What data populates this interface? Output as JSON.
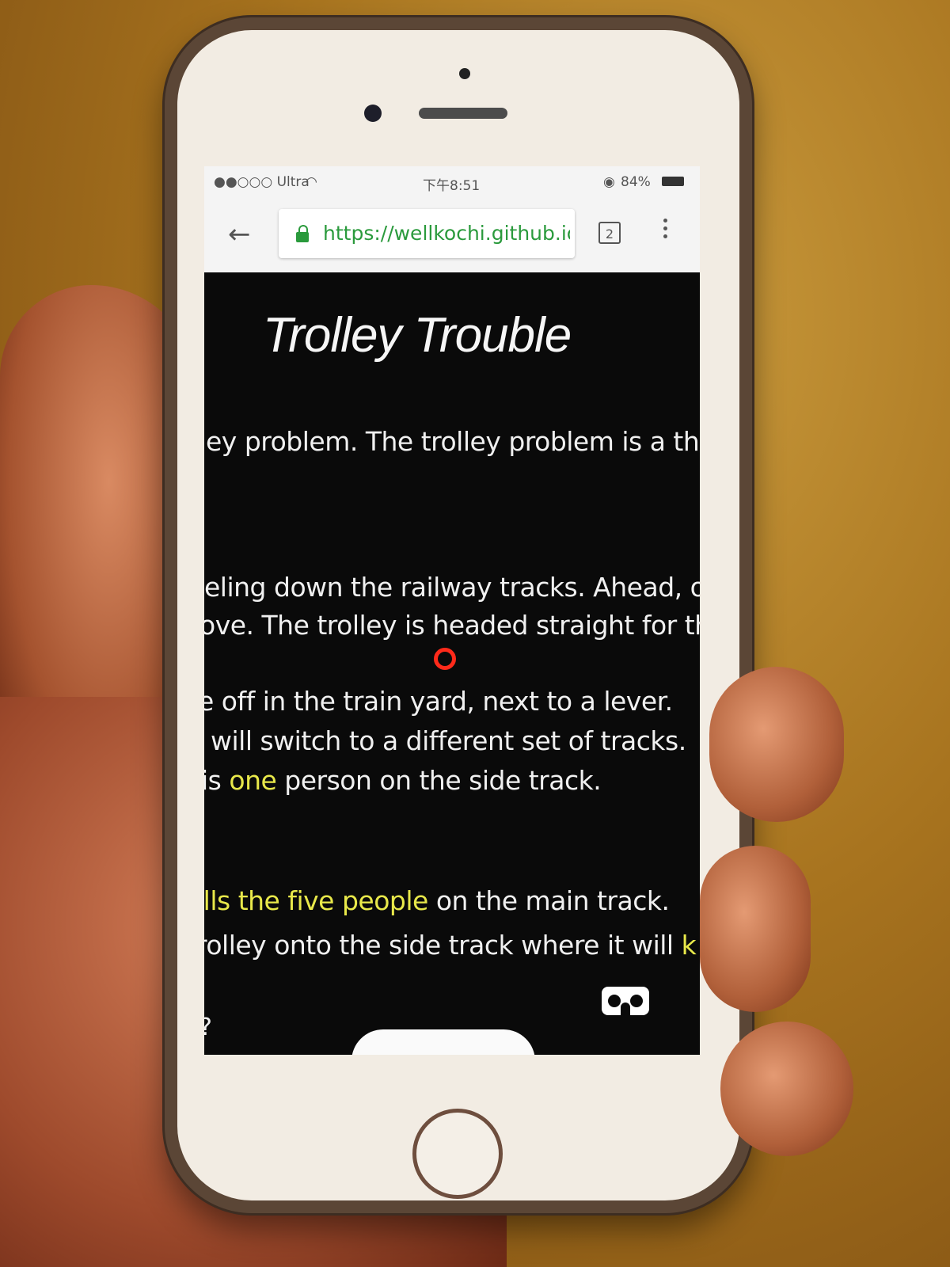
{
  "status_bar": {
    "carrier": "●●○○○ Ultra",
    "time": "下午8:51",
    "battery": "84%"
  },
  "browser": {
    "url": "https://wellkochi.github.io",
    "tab_count": "2"
  },
  "page": {
    "title": "Trolley Trouble",
    "lines": [
      "ey problem. The trolley problem is a thoug",
      "eling down the railway tracks. Ahead, on",
      "ove. The trolley is headed straight for the",
      "e off in the train yard, next to a lever.",
      "will switch to a different set of tracks.",
      "is",
      "one",
      "person on the side track.",
      "ills the five people",
      "on the main track.",
      "rolley onto the side track where it will",
      "k"
    ],
    "help": "?"
  },
  "colors": {
    "highlight": "#e8e84a",
    "reticle": "#ff2a1a",
    "url_green": "#2a9a3c"
  }
}
